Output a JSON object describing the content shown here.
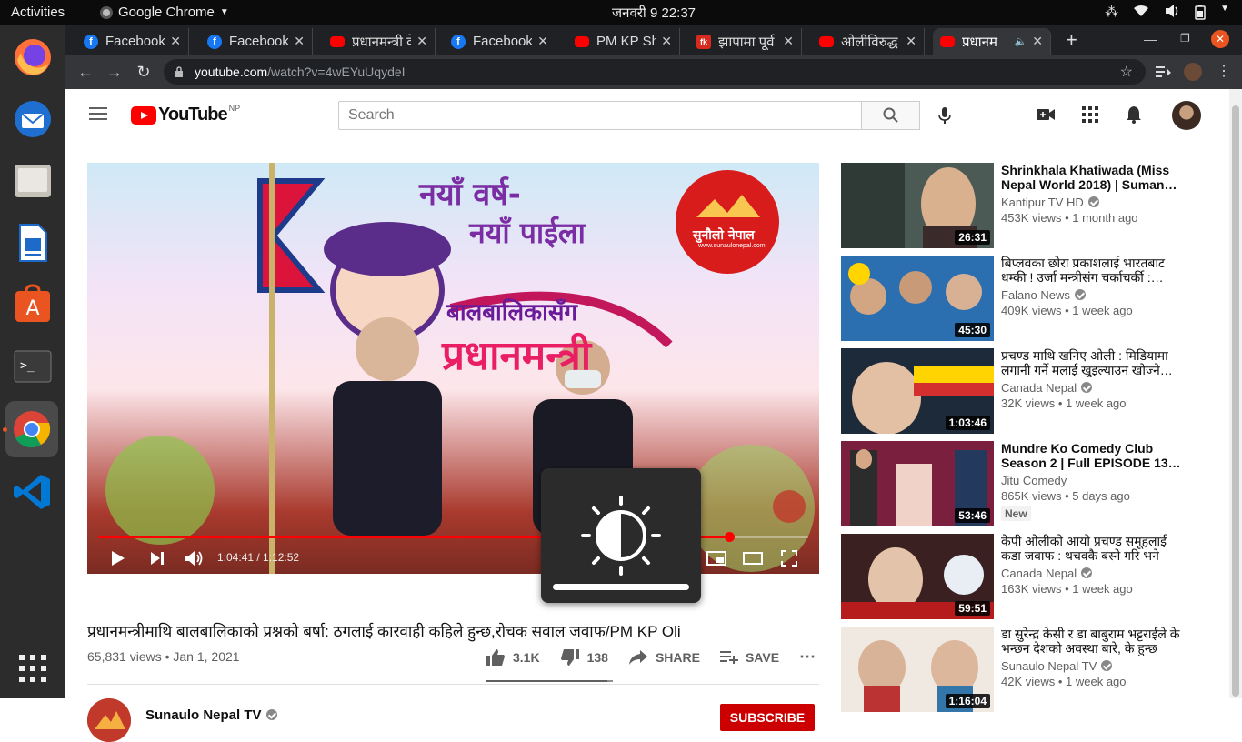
{
  "system": {
    "activities": "Activities",
    "app_name": "Google Chrome",
    "clock": "जनवरी 9  22:37"
  },
  "tabs": [
    {
      "label": "Facebook",
      "icon": "facebook-icon"
    },
    {
      "label": "Facebook",
      "icon": "facebook-icon"
    },
    {
      "label": "प्रधानमन्त्री वे",
      "icon": "youtube-icon"
    },
    {
      "label": "Facebook",
      "icon": "facebook-icon"
    },
    {
      "label": "PM KP Sha",
      "icon": "youtube-icon"
    },
    {
      "label": "झापामा पूर्व रा",
      "icon": "fk-icon"
    },
    {
      "label": "ओलीविरुद्ध र",
      "icon": "youtube-icon"
    },
    {
      "label": "प्रधानम",
      "icon": "youtube-icon"
    }
  ],
  "address": {
    "host": "youtube.com",
    "path": "/watch?v=4wEYuUqydeI"
  },
  "youtube": {
    "logo_text": "YouTube",
    "country": "NP",
    "search_placeholder": "Search"
  },
  "player": {
    "time": "1:04:41 / 1:12:52",
    "progress": 0.888,
    "banner_line1": "नयाँ वर्ष-",
    "banner_line2": "नयाँ पाईला",
    "banner_main": "प्रधानमन्त्री",
    "banner_sub": "बालबालिकासँग",
    "brand": "सुनौलो नेपाल",
    "brand_url": "www.sunaulonepal.com"
  },
  "video": {
    "title": "प्रधानमन्त्रीमाथि बालबालिकाको प्रश्नको बर्षा: ठगलाई कारवाही कहिले हुन्छ,रोचक सवाल जवाफ/PM KP Oli",
    "views_date": "65,831 views • Jan 1, 2021",
    "likes": "3.1K",
    "dislikes": "138",
    "share": "SHARE",
    "save": "SAVE",
    "channel": "Sunaulo Nepal TV",
    "subscribe": "SUBSCRIBE"
  },
  "recommendations": [
    {
      "title": "Shrinkhala Khatiwada (Miss Nepal World 2018) | Suman…",
      "channel": "Kantipur TV HD",
      "meta": "453K views • 1 month ago",
      "duration": "26:31"
    },
    {
      "title": "बिप्लवका छोरा प्रकाशलाई भारतबाट धम्की ! उर्जा मन्त्रीसंग चर्काचर्की :…",
      "channel": "Falano News",
      "meta": "409K views • 1 week ago",
      "duration": "45:30"
    },
    {
      "title": "प्रचण्ड माथि खनिए ओली : मिडियामा लगानी गर्ने मलाई खुइल्याउन खोज्ने…",
      "channel": "Canada Nepal",
      "meta": "32K views • 1 week ago",
      "duration": "1:03:46"
    },
    {
      "title": "Mundre Ko Comedy Club Season 2 | Full EPISODE 13…",
      "channel": "Jitu Comedy",
      "meta": "865K views • 5 days ago",
      "duration": "53:46",
      "badge": "New"
    },
    {
      "title": "केपी ओलीको आयो प्रचण्ड समूहलाई कडा जवाफ : थचक्कै बस्ने गरि भने प्याँ…",
      "channel": "Canada Nepal",
      "meta": "163K views • 1 week ago",
      "duration": "59:51"
    },
    {
      "title": "डा सुरेन्द्र केसी र डा बाबुराम भट्टराईले के भन्छन देशको अवस्था बारे, के हुन्छ अब…",
      "channel": "Sunaulo Nepal TV",
      "meta": "42K views • 1 week ago",
      "duration": "1:16:04"
    }
  ],
  "colors": {
    "youtube_red": "#ff0000",
    "chrome_dark": "#202124",
    "dock": "#2c2c2c"
  }
}
